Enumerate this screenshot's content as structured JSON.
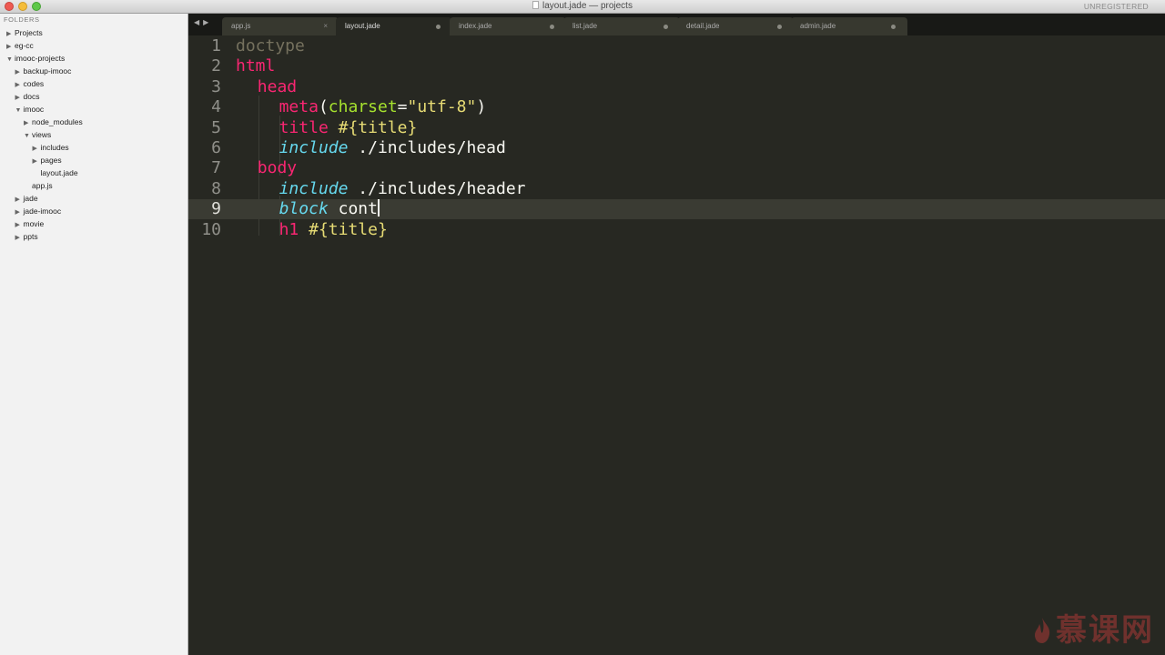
{
  "window": {
    "title": "layout.jade — projects",
    "unregistered": "UNREGISTERED"
  },
  "sidebar": {
    "heading": "FOLDERS",
    "items": [
      {
        "label": "Projects",
        "depth": 0,
        "expanded": false
      },
      {
        "label": "eg-cc",
        "depth": 0,
        "expanded": false
      },
      {
        "label": "imooc-projects",
        "depth": 0,
        "expanded": true
      },
      {
        "label": "backup-imooc",
        "depth": 1,
        "expanded": false
      },
      {
        "label": "codes",
        "depth": 1,
        "expanded": false
      },
      {
        "label": "docs",
        "depth": 1,
        "expanded": false
      },
      {
        "label": "imooc",
        "depth": 1,
        "expanded": true
      },
      {
        "label": "node_modules",
        "depth": 2,
        "expanded": false
      },
      {
        "label": "views",
        "depth": 2,
        "expanded": true
      },
      {
        "label": "includes",
        "depth": 3,
        "expanded": false
      },
      {
        "label": "pages",
        "depth": 3,
        "expanded": false
      },
      {
        "label": "layout.jade",
        "depth": 3,
        "file": true
      },
      {
        "label": "app.js",
        "depth": 2,
        "file": true
      },
      {
        "label": "jade",
        "depth": 1,
        "expanded": false
      },
      {
        "label": "jade-imooc",
        "depth": 1,
        "expanded": false
      },
      {
        "label": "movie",
        "depth": 1,
        "expanded": false
      },
      {
        "label": "ppts",
        "depth": 1,
        "expanded": false
      }
    ]
  },
  "tabs": [
    {
      "label": "app.js",
      "active": false,
      "marker": "×"
    },
    {
      "label": "layout.jade",
      "active": true,
      "marker": "dot"
    },
    {
      "label": "index.jade",
      "active": false,
      "marker": "dot"
    },
    {
      "label": "list.jade",
      "active": false,
      "marker": "dot"
    },
    {
      "label": "detail.jade",
      "active": false,
      "marker": "dot"
    },
    {
      "label": "admin.jade",
      "active": false,
      "marker": "dot"
    }
  ],
  "editor": {
    "current_line": 9,
    "lines": [
      {
        "n": "1",
        "indent": 0,
        "tokens": [
          [
            "doctype",
            "kw-doctype"
          ]
        ]
      },
      {
        "n": "2",
        "indent": 0,
        "tokens": [
          [
            "html",
            "kw-tag"
          ]
        ]
      },
      {
        "n": "3",
        "indent": 1,
        "tokens": [
          [
            "head",
            "kw-tag"
          ]
        ]
      },
      {
        "n": "4",
        "indent": 2,
        "tokens": [
          [
            "meta",
            "kw-tag"
          ],
          [
            "(",
            ""
          ],
          [
            "charset",
            "kw-attr"
          ],
          [
            "=",
            ""
          ],
          [
            "\"utf-8\"",
            "kw-str"
          ],
          [
            ")",
            ""
          ]
        ]
      },
      {
        "n": "5",
        "indent": 2,
        "tokens": [
          [
            "title",
            "kw-tag"
          ],
          [
            " ",
            ""
          ],
          [
            "#{title}",
            "kw-interp"
          ]
        ]
      },
      {
        "n": "6",
        "indent": 2,
        "tokens": [
          [
            "include",
            "kw-include"
          ],
          [
            " ./includes/head",
            ""
          ]
        ]
      },
      {
        "n": "7",
        "indent": 1,
        "tokens": [
          [
            "body",
            "kw-tag"
          ]
        ]
      },
      {
        "n": "8",
        "indent": 2,
        "tokens": [
          [
            "include",
            "kw-include"
          ],
          [
            " ./includes/header",
            ""
          ]
        ]
      },
      {
        "n": "9",
        "indent": 2,
        "tokens": [
          [
            "block",
            "kw-include"
          ],
          [
            " cont",
            ""
          ]
        ],
        "cursor": true
      },
      {
        "n": "10",
        "indent": 2,
        "tokens": [
          [
            "h1",
            "kw-tag"
          ],
          [
            " ",
            ""
          ],
          [
            "#{title}",
            "kw-interp"
          ]
        ]
      }
    ]
  },
  "watermark": {
    "text": "慕课网",
    "color": "#c83c3c"
  },
  "colors": {
    "editor_bg": "#272822",
    "tag": "#f92672",
    "attr": "#a6e22e",
    "string": "#e6db74",
    "keyword_italic": "#66d9ef",
    "comment": "#75715e"
  }
}
